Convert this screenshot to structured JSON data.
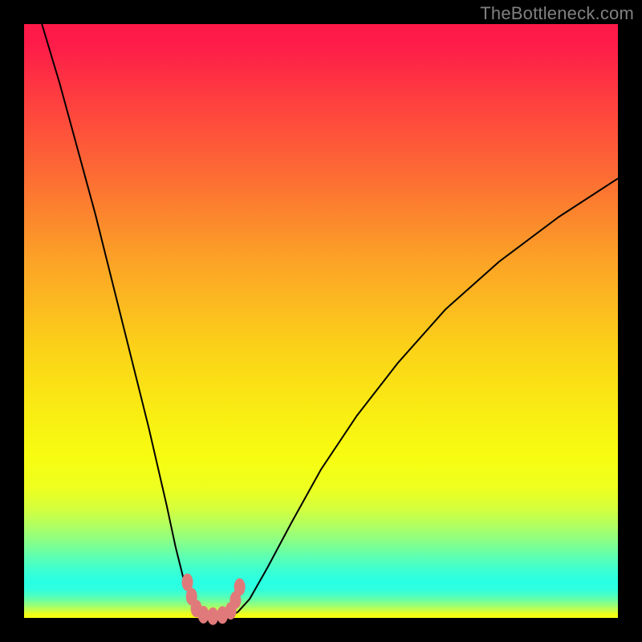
{
  "watermark": "TheBottleneck.com",
  "chart_data": {
    "type": "line",
    "title": "",
    "xlabel": "",
    "ylabel": "",
    "xlim": [
      0,
      100
    ],
    "ylim": [
      0,
      100
    ],
    "series": [
      {
        "name": "bottleneck-curve",
        "x": [
          3,
          6,
          9,
          12,
          15,
          18,
          21,
          24,
          25.5,
          27,
          28.5,
          30,
          31,
          32,
          33,
          34,
          35,
          36,
          38,
          41,
          45,
          50,
          56,
          63,
          71,
          80,
          90,
          100
        ],
        "values": [
          100,
          90,
          79,
          68,
          56,
          44,
          32,
          19,
          12,
          6,
          2.2,
          0.6,
          0.3,
          0.3,
          0.3,
          0.3,
          0.5,
          1.0,
          3.2,
          8.5,
          16,
          25,
          34,
          43,
          52,
          60,
          67.5,
          74
        ]
      },
      {
        "name": "trough-markers",
        "x": [
          27.5,
          28.2,
          29.0,
          30.2,
          31.8,
          33.4,
          34.8,
          35.6,
          36.3
        ],
        "values": [
          6.0,
          3.6,
          1.6,
          0.55,
          0.3,
          0.5,
          1.2,
          3.0,
          5.2
        ]
      }
    ],
    "background_gradient": {
      "top": "#fe1a49",
      "mid": "#fcd318",
      "mid2": "#87ff89",
      "bottom": "#f6ff0e"
    }
  }
}
